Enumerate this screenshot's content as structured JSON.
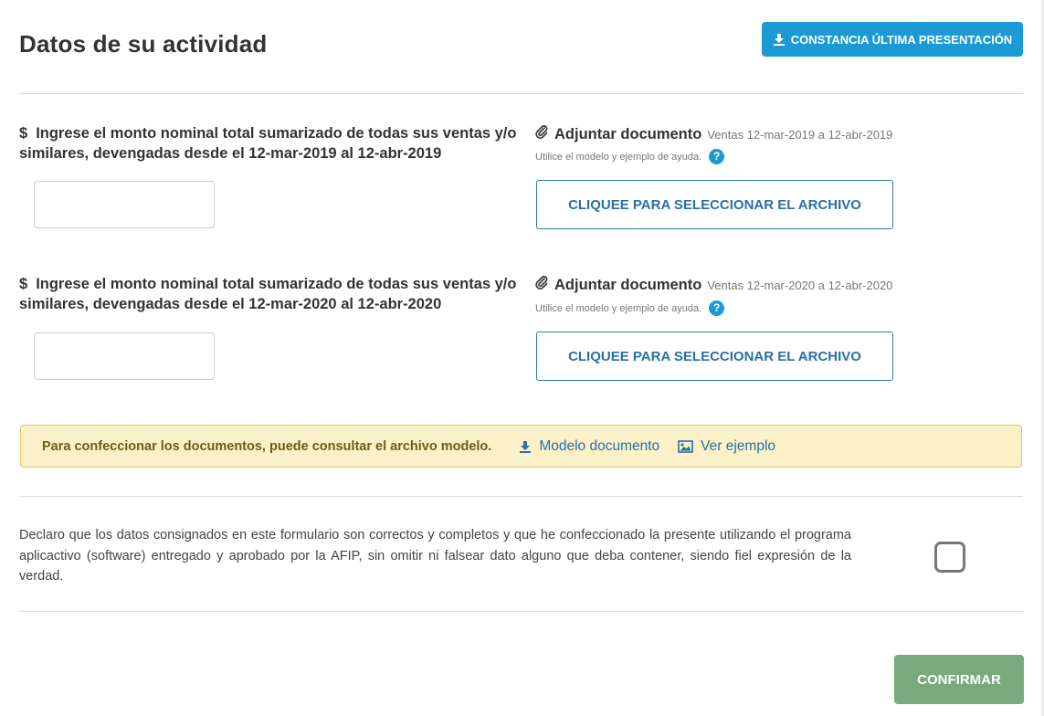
{
  "page_title": "Datos de su actividad",
  "constancia_button": {
    "label": "CONSTANCIA ÚLTIMA PRESENTACIÓN",
    "icon": "download-icon"
  },
  "questions": [
    {
      "currency_symbol": "$",
      "label": "Ingrese el monto nominal total sumarizado de todas sus ventas y/o similares, devengadas desde el 12-mar-2019 al 12-abr-2019",
      "amount_value": "",
      "attach_title": "Adjuntar documento",
      "attach_period": "Ventas 12-mar-2019 a 12-abr-2019",
      "help_text": "Utilice el modelo y ejemplo de ayuda.",
      "help_icon": "?",
      "file_button_label": "CLIQUEE PARA SELECCIONAR EL ARCHIVO"
    },
    {
      "currency_symbol": "$",
      "label": "Ingrese el monto nominal total sumarizado de todas sus ventas y/o similares, devengadas desde el 12-mar-2020 al 12-abr-2020",
      "amount_value": "",
      "attach_title": "Adjuntar documento",
      "attach_period": "Ventas 12-mar-2020 a 12-abr-2020",
      "help_text": "Utilice el modelo y ejemplo de ayuda.",
      "help_icon": "?",
      "file_button_label": "CLIQUEE PARA SELECCIONAR EL ARCHIVO"
    }
  ],
  "notice": {
    "text": "Para confeccionar los documentos, puede consultar el archivo modelo.",
    "model_link": "Modelo documento",
    "example_link": "Ver ejemplo"
  },
  "declaration": {
    "text": "Declaro que los datos consignados en este formulario son correctos y completos y que he confeccionado la presente utilizando el programa aplicactivo (software) entregado y aprobado por la AFIP, sin omitir ni falsear dato alguno que deba contener, siendo fiel expresión de la verdad.",
    "checked": false
  },
  "confirm_button": {
    "label": "CONFIRMAR"
  },
  "colors": {
    "primary": "#1c9ad6",
    "link": "#2a6fa5",
    "notice_bg": "#fbf1c8",
    "notice_border": "#e3c766",
    "confirm": "#79aa7e"
  }
}
